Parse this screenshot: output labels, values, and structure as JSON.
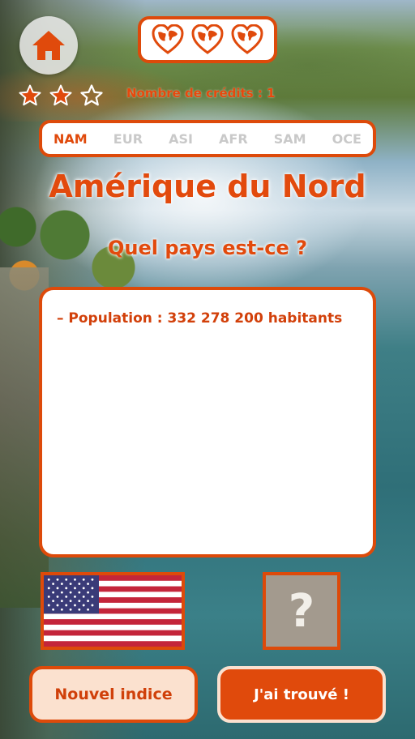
{
  "colors": {
    "accent": "#E04A0C",
    "accent_light": "#FBE1CF",
    "inactive_tab": "#C9C9C9",
    "mystery_bg": "#A39A8E"
  },
  "header": {
    "home_icon": "home-icon",
    "lives": {
      "count": 3,
      "icon": "heart-globe-icon"
    },
    "stars": {
      "filled": 2,
      "total": 3
    },
    "credits_text": "Nombre de crédits : 1"
  },
  "region_tabs": [
    {
      "label": "NAM",
      "active": true
    },
    {
      "label": "EUR",
      "active": false
    },
    {
      "label": "ASI",
      "active": false
    },
    {
      "label": "AFR",
      "active": false
    },
    {
      "label": "SAM",
      "active": false
    },
    {
      "label": "OCE",
      "active": false
    }
  ],
  "region_title": "Amérique du Nord",
  "question": "Quel pays est-ce ?",
  "hints": [
    "– Population : 332 278 200 habitants"
  ],
  "flag": {
    "icon": "us-flag"
  },
  "mystery_symbol": "?",
  "buttons": {
    "new_hint": "Nouvel indice",
    "found": "J'ai trouvé !"
  }
}
